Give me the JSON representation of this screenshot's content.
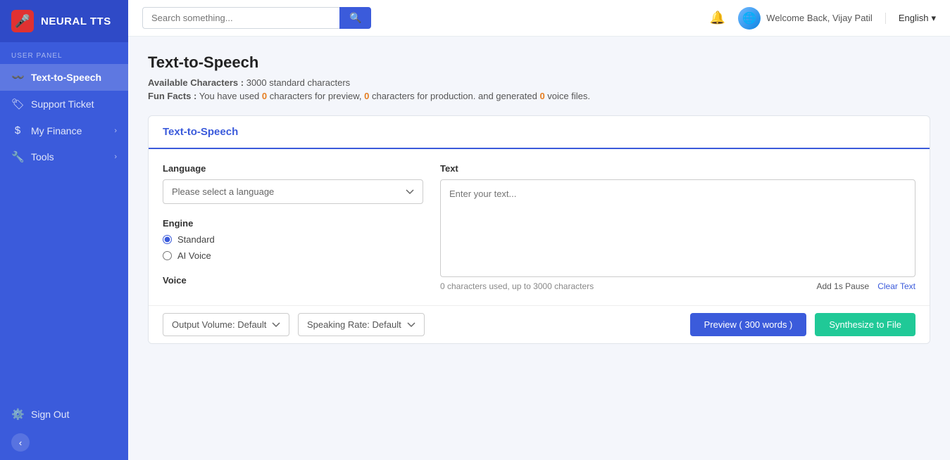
{
  "app": {
    "name": "NEURAL TTS",
    "logo_icon": "🎙️"
  },
  "sidebar": {
    "section_label": "USER PANEL",
    "items": [
      {
        "id": "text-to-speech",
        "label": "Text-to-Speech",
        "icon": "🎵",
        "active": true,
        "has_chevron": false
      },
      {
        "id": "support-ticket",
        "label": "Support Ticket",
        "icon": "🏷️",
        "active": false,
        "has_chevron": false
      },
      {
        "id": "my-finance",
        "label": "My Finance",
        "icon": "$",
        "active": false,
        "has_chevron": true
      },
      {
        "id": "tools",
        "label": "Tools",
        "icon": "🔧",
        "active": false,
        "has_chevron": true
      },
      {
        "id": "sign-out",
        "label": "Sign Out",
        "icon": "⚙️",
        "active": false,
        "has_chevron": false
      }
    ],
    "collapse_icon": "‹"
  },
  "header": {
    "search_placeholder": "Search something...",
    "search_icon": "🔍",
    "welcome_text": "Welcome Back, Vijay Patil",
    "language": "English",
    "language_dropdown_icon": "▾"
  },
  "page": {
    "title": "Text-to-Speech",
    "available_chars_label": "Available Characters :",
    "available_chars_value": "3000 standard characters",
    "fun_facts_label": "Fun Facts :",
    "fun_facts_text": "You have used",
    "chars_preview": "0",
    "chars_for_preview_text": "characters for preview,",
    "chars_production": "0",
    "chars_production_text": "characters for production.",
    "voice_files": "0",
    "voice_files_text": "and generated",
    "voice_files_suffix": "voice files."
  },
  "tts_card": {
    "title": "Text-to-Speech",
    "language_label": "Language",
    "language_placeholder": "Please select a language",
    "engine_label": "Engine",
    "engine_options": [
      {
        "value": "standard",
        "label": "Standard",
        "checked": true
      },
      {
        "value": "ai-voice",
        "label": "AI Voice",
        "checked": false
      }
    ],
    "voice_label": "Voice",
    "text_label": "Text",
    "text_placeholder": "Enter your text...",
    "chars_used": "0 characters used, up to 3000 characters",
    "add_pause_label": "Add 1s Pause",
    "clear_label": "Clear Text",
    "output_volume_label": "Output Volume: Default",
    "speaking_rate_label": "Speaking Rate: Default",
    "preview_btn_label": "Preview ( 300 words )",
    "synthesize_btn_label": "Synthesize to File"
  }
}
